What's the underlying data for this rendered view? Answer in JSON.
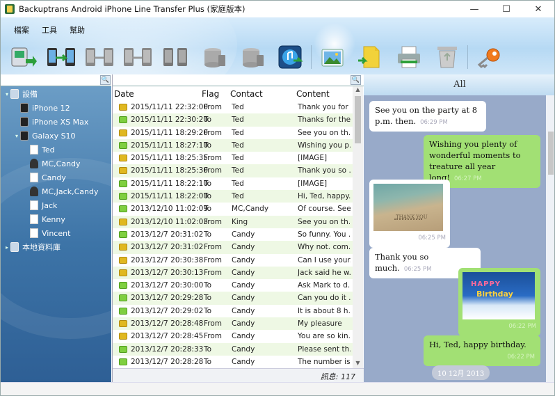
{
  "window": {
    "title": "Backuptrans Android iPhone Line Transfer Plus (家庭版本)",
    "minimize": "—",
    "maximize": "☐",
    "close": "✕"
  },
  "menu": [
    "檔案",
    "工具",
    "幫助"
  ],
  "toolbar": [
    {
      "name": "backup-icon"
    },
    {
      "name": "transfer-icon"
    },
    {
      "name": "phone-to-phone-icon"
    },
    {
      "name": "restore-icon"
    },
    {
      "name": "phone-sync-icon"
    },
    {
      "name": "export-icon"
    },
    {
      "name": "import-icon"
    },
    {
      "name": "itunes-icon"
    },
    {
      "name": "photo-icon"
    },
    {
      "name": "file-icon"
    },
    {
      "name": "print-icon"
    },
    {
      "name": "recycle-bin-icon"
    },
    {
      "name": "key-icon"
    }
  ],
  "tree": {
    "devices_label": "設備",
    "devices": [
      {
        "label": "iPhone 12",
        "type": "phone",
        "level": 1
      },
      {
        "label": "iPhone XS Max",
        "type": "phone",
        "level": 1
      },
      {
        "label": "Galaxy S10",
        "type": "phone",
        "level": 1,
        "expanded": true
      },
      {
        "label": "Ted",
        "type": "contact",
        "level": 2
      },
      {
        "label": "MC,Candy",
        "type": "group",
        "level": 2
      },
      {
        "label": "Candy",
        "type": "contact",
        "level": 2
      },
      {
        "label": "MC,Jack,Candy",
        "type": "group",
        "level": 2
      },
      {
        "label": "Jack",
        "type": "contact",
        "level": 2
      },
      {
        "label": "Kenny",
        "type": "contact",
        "level": 2
      },
      {
        "label": "Vincent",
        "type": "contact",
        "level": 2
      }
    ],
    "local_db_label": "本地資料庫"
  },
  "table": {
    "headers": {
      "date": "Date",
      "flag": "Flag",
      "contact": "Contact",
      "content": "Content"
    },
    "rows": [
      {
        "date": "2015/11/11 22:32:00",
        "flag": "From",
        "contact": "Ted",
        "content": "Thank you for ..."
      },
      {
        "date": "2015/11/11 22:30:20",
        "flag": "To",
        "contact": "Ted",
        "content": "Thanks for the..."
      },
      {
        "date": "2015/11/11 18:29:20",
        "flag": "From",
        "contact": "Ted",
        "content": "See you on th..."
      },
      {
        "date": "2015/11/11 18:27:10",
        "flag": "To",
        "contact": "Ted",
        "content": "Wishing you p..."
      },
      {
        "date": "2015/11/11 18:25:35",
        "flag": "From",
        "contact": "Ted",
        "content": "[IMAGE]"
      },
      {
        "date": "2015/11/11 18:25:30",
        "flag": "From",
        "contact": "Ted",
        "content": "Thank you so ..."
      },
      {
        "date": "2015/11/11 18:22:10",
        "flag": "To",
        "contact": "Ted",
        "content": "[IMAGE]"
      },
      {
        "date": "2015/11/11 18:22:00",
        "flag": "To",
        "contact": "Ted",
        "content": "Hi, Ted, happy..."
      },
      {
        "date": "2013/12/10 11:02:09",
        "flag": "To",
        "contact": "MC,Candy",
        "content": "Of course. See..."
      },
      {
        "date": "2013/12/10 11:02:03",
        "flag": "From",
        "contact": "King",
        "content": "See you on th..."
      },
      {
        "date": "2013/12/7 20:31:02",
        "flag": "To",
        "contact": "Candy",
        "content": "So funny. You ..."
      },
      {
        "date": "2013/12/7 20:31:02",
        "flag": "From",
        "contact": "Candy",
        "content": "Why not. com..."
      },
      {
        "date": "2013/12/7 20:30:38",
        "flag": "From",
        "contact": "Candy",
        "content": "Can I use your..."
      },
      {
        "date": "2013/12/7 20:30:13",
        "flag": "From",
        "contact": "Candy",
        "content": "Jack said he w..."
      },
      {
        "date": "2013/12/7 20:30:00",
        "flag": "To",
        "contact": "Candy",
        "content": "Ask Mark to d..."
      },
      {
        "date": "2013/12/7 20:29:28",
        "flag": "To",
        "contact": "Candy",
        "content": "Can you do it ..."
      },
      {
        "date": "2013/12/7 20:29:02",
        "flag": "To",
        "contact": "Candy",
        "content": "It is about 8 h..."
      },
      {
        "date": "2013/12/7 20:28:48",
        "flag": "From",
        "contact": "Candy",
        "content": "My pleasure"
      },
      {
        "date": "2013/12/7 20:28:45",
        "flag": "From",
        "contact": "Candy",
        "content": "You are so kin..."
      },
      {
        "date": "2013/12/7 20:28:33",
        "flag": "To",
        "contact": "Candy",
        "content": "Please sent th..."
      },
      {
        "date": "2013/12/7 20:28:28",
        "flag": "To",
        "contact": "Candy",
        "content": "The number is..."
      }
    ]
  },
  "status": {
    "count_text": "訊息: 117"
  },
  "conversation": {
    "header": "All",
    "messages": [
      {
        "dir": "in",
        "text": "See you on the party at 8 p.m. then.",
        "time": "06:29 PM"
      },
      {
        "dir": "out",
        "text": "Wishing you plenty of wonderful moments to treature all year long!",
        "time": "06:27 PM"
      },
      {
        "dir": "in",
        "image": "beach-photo",
        "image_text": "THANK YOU",
        "time": "06:25 PM"
      },
      {
        "dir": "in",
        "text": "Thank you so much.",
        "time": "06:25 PM"
      },
      {
        "dir": "out",
        "image": "birthday-cake-photo",
        "image_text_1": "HAPPY",
        "image_text_2": "Birthday",
        "time": "06:22 PM"
      },
      {
        "dir": "out",
        "text": "Hi, Ted, happy birthday.",
        "time": "06:22 PM"
      }
    ],
    "date_chip": "10 12月 2013"
  },
  "colors": {
    "accent_green": "#a2e074",
    "chat_bg": "#98aac9",
    "tree_bg": "#3d74a7",
    "row_alt": "#eef8e4"
  }
}
